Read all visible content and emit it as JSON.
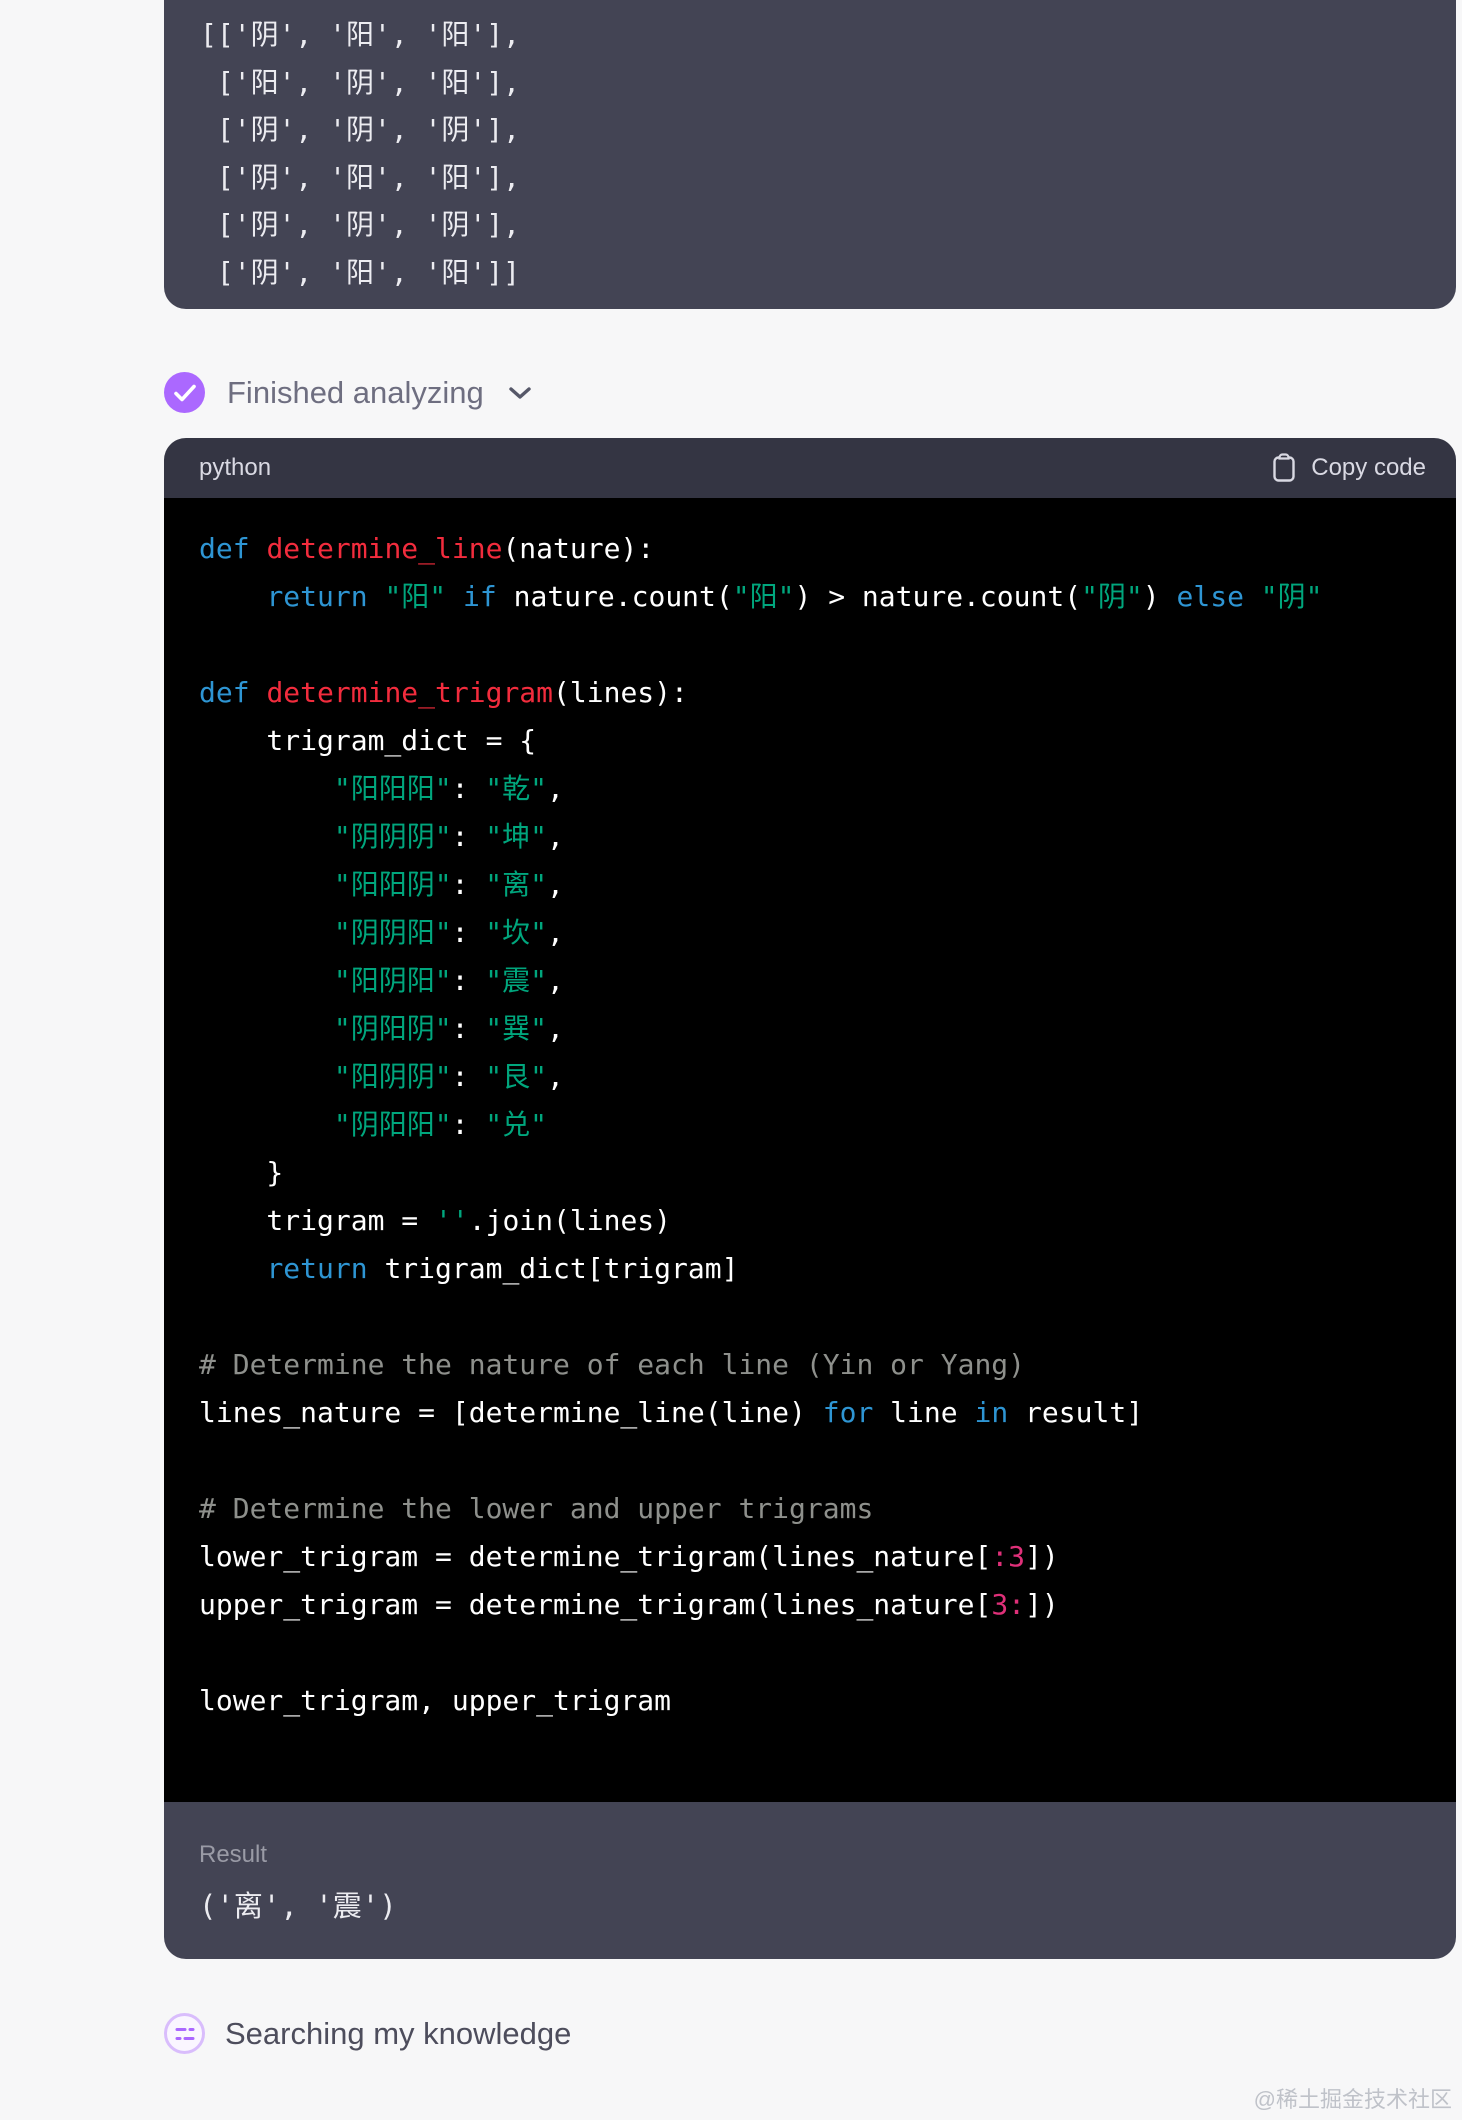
{
  "output_block": {
    "lines": [
      "[['阴', '阳', '阳'],",
      " ['阳', '阴', '阳'],",
      " ['阴', '阴', '阴'],",
      " ['阴', '阳', '阳'],",
      " ['阴', '阴', '阴'],",
      " ['阴', '阳', '阳']]"
    ]
  },
  "status": {
    "label": "Finished analyzing",
    "icon": "check-circle-icon"
  },
  "code_block": {
    "language": "python",
    "copy_label": "Copy code",
    "copy_icon": "clipboard-icon",
    "lines": [
      [
        {
          "t": "def ",
          "c": "kw"
        },
        {
          "t": "determine_line",
          "c": "fn"
        },
        {
          "t": "(nature):",
          "c": "pl"
        }
      ],
      [
        {
          "t": "    ",
          "c": "pl"
        },
        {
          "t": "return",
          "c": "kw"
        },
        {
          "t": " ",
          "c": "pl"
        },
        {
          "t": "\"阳\"",
          "c": "str"
        },
        {
          "t": " ",
          "c": "pl"
        },
        {
          "t": "if",
          "c": "kw"
        },
        {
          "t": " nature.count(",
          "c": "pl"
        },
        {
          "t": "\"阳\"",
          "c": "str"
        },
        {
          "t": ") > nature.count(",
          "c": "pl"
        },
        {
          "t": "\"阴\"",
          "c": "str"
        },
        {
          "t": ") ",
          "c": "pl"
        },
        {
          "t": "else",
          "c": "kw"
        },
        {
          "t": " ",
          "c": "pl"
        },
        {
          "t": "\"阴\"",
          "c": "str"
        }
      ],
      "",
      [
        {
          "t": "def ",
          "c": "kw"
        },
        {
          "t": "determine_trigram",
          "c": "fn"
        },
        {
          "t": "(lines):",
          "c": "pl"
        }
      ],
      [
        {
          "t": "    trigram_dict = {",
          "c": "pl"
        }
      ],
      [
        {
          "t": "        ",
          "c": "pl"
        },
        {
          "t": "\"阳阳阳\"",
          "c": "str"
        },
        {
          "t": ": ",
          "c": "pl"
        },
        {
          "t": "\"乾\"",
          "c": "str"
        },
        {
          "t": ",",
          "c": "pl"
        }
      ],
      [
        {
          "t": "        ",
          "c": "pl"
        },
        {
          "t": "\"阴阴阴\"",
          "c": "str"
        },
        {
          "t": ": ",
          "c": "pl"
        },
        {
          "t": "\"坤\"",
          "c": "str"
        },
        {
          "t": ",",
          "c": "pl"
        }
      ],
      [
        {
          "t": "        ",
          "c": "pl"
        },
        {
          "t": "\"阳阳阴\"",
          "c": "str"
        },
        {
          "t": ": ",
          "c": "pl"
        },
        {
          "t": "\"离\"",
          "c": "str"
        },
        {
          "t": ",",
          "c": "pl"
        }
      ],
      [
        {
          "t": "        ",
          "c": "pl"
        },
        {
          "t": "\"阴阴阳\"",
          "c": "str"
        },
        {
          "t": ": ",
          "c": "pl"
        },
        {
          "t": "\"坎\"",
          "c": "str"
        },
        {
          "t": ",",
          "c": "pl"
        }
      ],
      [
        {
          "t": "        ",
          "c": "pl"
        },
        {
          "t": "\"阳阴阳\"",
          "c": "str"
        },
        {
          "t": ": ",
          "c": "pl"
        },
        {
          "t": "\"震\"",
          "c": "str"
        },
        {
          "t": ",",
          "c": "pl"
        }
      ],
      [
        {
          "t": "        ",
          "c": "pl"
        },
        {
          "t": "\"阴阳阴\"",
          "c": "str"
        },
        {
          "t": ": ",
          "c": "pl"
        },
        {
          "t": "\"巽\"",
          "c": "str"
        },
        {
          "t": ",",
          "c": "pl"
        }
      ],
      [
        {
          "t": "        ",
          "c": "pl"
        },
        {
          "t": "\"阳阴阴\"",
          "c": "str"
        },
        {
          "t": ": ",
          "c": "pl"
        },
        {
          "t": "\"艮\"",
          "c": "str"
        },
        {
          "t": ",",
          "c": "pl"
        }
      ],
      [
        {
          "t": "        ",
          "c": "pl"
        },
        {
          "t": "\"阴阳阳\"",
          "c": "str"
        },
        {
          "t": ": ",
          "c": "pl"
        },
        {
          "t": "\"兑\"",
          "c": "str"
        }
      ],
      [
        {
          "t": "    }",
          "c": "pl"
        }
      ],
      [
        {
          "t": "    trigram = ",
          "c": "pl"
        },
        {
          "t": "''",
          "c": "str"
        },
        {
          "t": ".join(lines)",
          "c": "pl"
        }
      ],
      [
        {
          "t": "    ",
          "c": "pl"
        },
        {
          "t": "return",
          "c": "kw"
        },
        {
          "t": " trigram_dict[trigram]",
          "c": "pl"
        }
      ],
      "",
      [
        {
          "t": "# Determine the nature of each line (Yin or Yang)",
          "c": "cm"
        }
      ],
      [
        {
          "t": "lines_nature = [determine_line(line) ",
          "c": "pl"
        },
        {
          "t": "for",
          "c": "kw"
        },
        {
          "t": " line ",
          "c": "pl"
        },
        {
          "t": "in",
          "c": "kw"
        },
        {
          "t": " result]",
          "c": "pl"
        }
      ],
      "",
      [
        {
          "t": "# Determine the lower and upper trigrams",
          "c": "cm"
        }
      ],
      [
        {
          "t": "lower_trigram = determine_trigram(lines_nature[",
          "c": "pl"
        },
        {
          "t": ":3",
          "c": "num"
        },
        {
          "t": "])",
          "c": "pl"
        }
      ],
      [
        {
          "t": "upper_trigram = determine_trigram(lines_nature[",
          "c": "pl"
        },
        {
          "t": "3:",
          "c": "num"
        },
        {
          "t": "])",
          "c": "pl"
        }
      ],
      "",
      [
        {
          "t": "lower_trigram, upper_trigram",
          "c": "pl"
        }
      ]
    ],
    "result": {
      "label": "Result",
      "value": "('离', '震')"
    }
  },
  "knowledge_status": {
    "label": "Searching my knowledge",
    "icon": "knowledge-icon"
  },
  "watermark": "@稀土掘金技术社区",
  "colors": {
    "page_bg": "#f7f7f8",
    "output_block_bg": "#434454",
    "code_header_bg": "#343543",
    "code_bg": "#000000",
    "accent_purple": "#ab68ff",
    "keyword": "#2e95d3",
    "function": "#f22c3d",
    "string": "#00a67d",
    "number": "#df3079",
    "comment": "#8e908c"
  }
}
